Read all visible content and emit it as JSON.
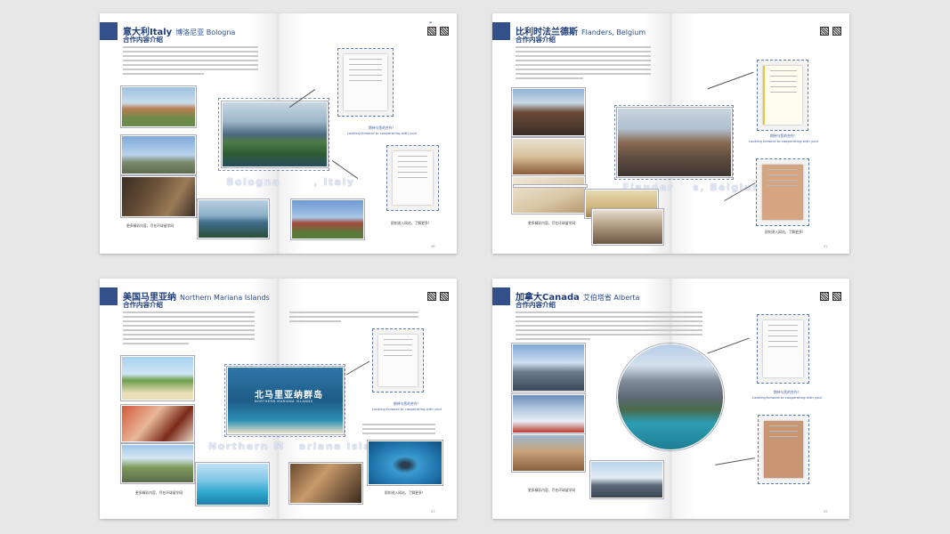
{
  "spreads": [
    {
      "title_cn": "意大利Italy",
      "title_en": "博洛尼亚 Bologna",
      "subtitle": "合作内容介绍",
      "big_text_a": "Bologna",
      "big_text_b": ", Italy",
      "caption_cn": "期待与您的合作！",
      "caption_en": "Looking forward to cooperating with you!",
      "note_left": "更多精彩内容，尽在环球留学网",
      "note_right": "即刻进入网站，了解更多！"
    },
    {
      "title_cn": "比利时法兰德斯",
      "title_en": "Flanders, Belgium",
      "subtitle": "合作内容介绍",
      "big_text_a": "Flander",
      "big_text_b": "s, Belgium",
      "caption_cn": "期待与您的合作！",
      "caption_en": "Looking forward to cooperating with you!",
      "note_left": "更多精彩内容，尽在环球留学网",
      "note_right": "即刻进入网站，了解更多！"
    },
    {
      "title_cn": "美国马里亚纳",
      "title_en": "Northern Mariana Islands",
      "subtitle": "合作内容介绍",
      "poster_cn": "北马里亚纳群岛",
      "poster_en": "NORTHERN MARIANA ISLANDS",
      "big_text_a": "Northern M",
      "big_text_b": "ariana Islands",
      "caption_cn": "期待与您的合作！",
      "caption_en": "Looking forward to cooperating with you!",
      "note_left": "更多精彩内容，尽在环球留学网",
      "note_right": "即刻进入网站，了解更多！"
    },
    {
      "title_cn": "加拿大Canada",
      "title_en": "艾伯塔省 Alberta",
      "subtitle": "合作内容介绍",
      "caption_cn": "期待与您的合作！",
      "caption_en": "Looking forward to cooperating with you!",
      "note_left": "更多精彩内容，尽在环球留学网",
      "note_right": "即刻进入网站，了解更多！"
    }
  ]
}
